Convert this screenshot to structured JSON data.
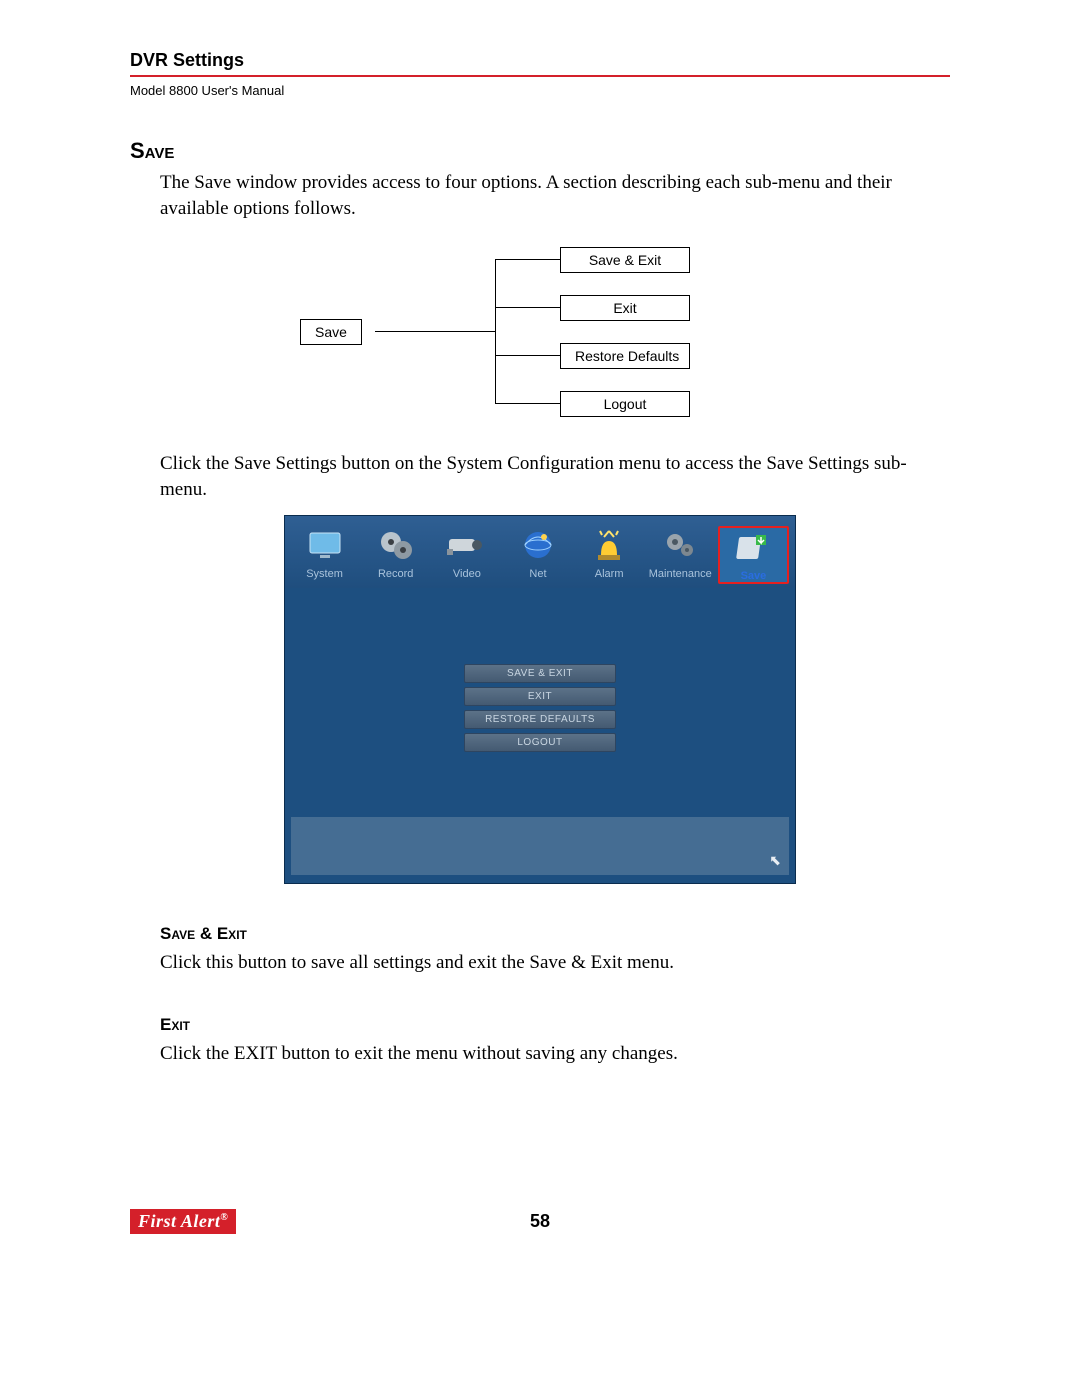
{
  "header": {
    "title": "DVR Settings",
    "manual": "Model 8800 User's Manual"
  },
  "section_save": {
    "heading": "Save",
    "intro": "The Save window provides access to four options. A section describing each sub-menu and their available options follows.",
    "post_diagram": "Click the Save Settings button on the System Configuration menu to access the Save Settings sub-menu."
  },
  "diagram": {
    "root": "Save",
    "children": [
      "Save & Exit",
      "Exit",
      "Restore Defaults",
      "Logout"
    ]
  },
  "screenshot": {
    "tabs": [
      {
        "label": "System",
        "icon": "monitor"
      },
      {
        "label": "Record",
        "icon": "reel"
      },
      {
        "label": "Video",
        "icon": "camera"
      },
      {
        "label": "Net",
        "icon": "globe"
      },
      {
        "label": "Alarm",
        "icon": "siren"
      },
      {
        "label": "Maintenance",
        "icon": "gears"
      },
      {
        "label": "Save",
        "icon": "disk",
        "active": true
      }
    ],
    "buttons": [
      "SAVE & EXIT",
      "EXIT",
      "RESTORE DEFAULTS",
      "LOGOUT"
    ]
  },
  "subsection_save_exit": {
    "heading": "Save & Exit",
    "text": "Click this button to save all settings and exit the Save & Exit menu."
  },
  "subsection_exit": {
    "heading": "Exit",
    "text": "Click the EXIT button to exit the menu without saving any changes."
  },
  "footer": {
    "page": "58",
    "brand": "First Alert"
  }
}
